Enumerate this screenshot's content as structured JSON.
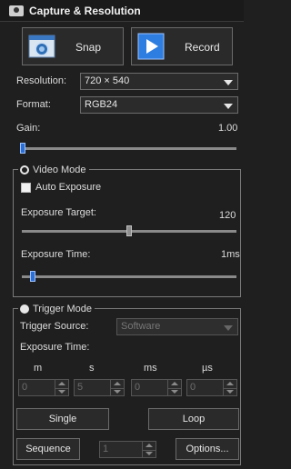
{
  "titlebar": {
    "title": "Capture & Resolution",
    "icon": "camera-icon"
  },
  "buttons": {
    "snap": "Snap",
    "record": "Record",
    "single": "Single",
    "loop": "Loop",
    "sequence": "Sequence",
    "options": "Options..."
  },
  "resolution": {
    "label": "Resolution:",
    "value": "720 × 540"
  },
  "format": {
    "label": "Format:",
    "value": "RGB24"
  },
  "gain": {
    "label": "Gain:",
    "value": "1.00",
    "level": 0.0
  },
  "video_mode": {
    "title": "Video Mode",
    "auto_exposure_label": "Auto Exposure",
    "auto_exposure_checked": false,
    "exposure_target_label": "Exposure Target:",
    "exposure_target_value": "120",
    "exposure_target_level": 0.5,
    "exposure_time_label": "Exposure Time:",
    "exposure_time_value": "1ms",
    "exposure_time_level": 0.04
  },
  "trigger_mode": {
    "title": "Trigger Mode",
    "source_label": "Trigger Source:",
    "source_value": "Software",
    "exposure_time_label": "Exposure Time:",
    "units": [
      "m",
      "s",
      "ms",
      "µs"
    ],
    "values": [
      "0",
      "5",
      "0",
      "0"
    ],
    "sequence_count": "1"
  },
  "colors": {
    "accent": "#2b6fd6",
    "background": "#1f1f1f",
    "border": "#7a7a7a"
  }
}
